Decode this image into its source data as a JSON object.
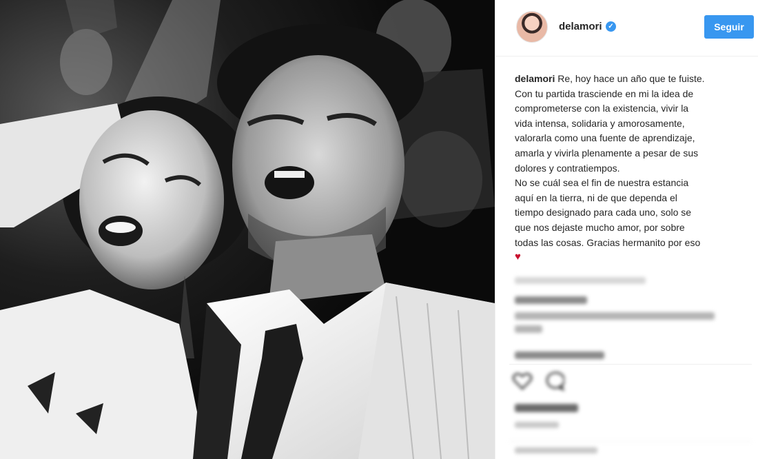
{
  "post": {
    "username": "delamori",
    "verified": true,
    "follow_label": "Seguir",
    "caption_user": "delamori",
    "caption_lines": [
      " Re, hoy hace un año que te fuiste.",
      "Con tu partida trasciende en mi la idea de",
      "comprometerse con la existencia, vivir la",
      "vida intensa, solidaria y amorosamente,",
      "valorarla como una fuente de aprendizaje,",
      "amarla y vivirla plenamente a pesar de sus",
      "dolores y contratiempos.",
      "No se cuál sea el fin de nuestra estancia",
      "aquí en la tierra, ni de que dependa el",
      "tiempo designado para cada uno, solo se",
      "que nos dejaste mucho amor, por sobre",
      "todas las cosas. Gracias hermanito por eso"
    ],
    "caption_emoji": "♥"
  },
  "icons": {
    "verified": "verified-badge-icon",
    "like": "heart-outline-icon",
    "comment": "comment-bubble-icon"
  },
  "colors": {
    "accent": "#3897f0",
    "heart": "#c8102e"
  }
}
